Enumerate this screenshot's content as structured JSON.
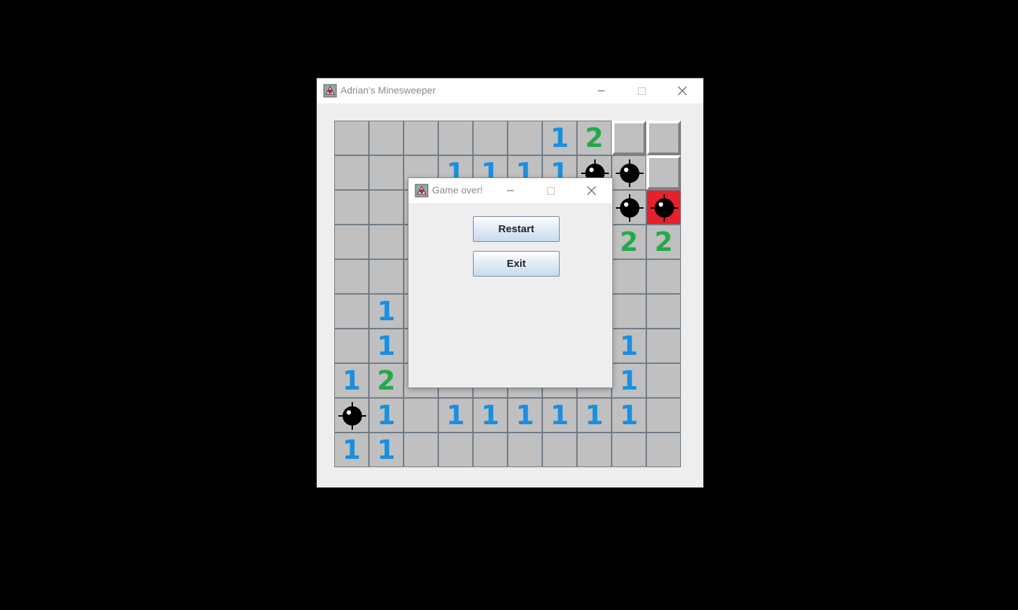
{
  "window": {
    "title": "Adrian's Minesweeper"
  },
  "dialog": {
    "title": "Game over!",
    "restart_label": "Restart",
    "exit_label": "Exit"
  },
  "colors": {
    "one": "#1a8fe0",
    "two": "#23a94a",
    "mine": "#000000",
    "exploded": "#e8202a"
  },
  "board": {
    "rows": 10,
    "cols": 10,
    "cells": [
      [
        "",
        "",
        "",
        "",
        "",
        "",
        "1",
        "2",
        "#",
        "#"
      ],
      [
        "",
        "",
        "",
        "1",
        "1",
        "1",
        "1",
        "*",
        "*",
        "#"
      ],
      [
        "",
        "",
        "",
        "",
        "",
        "",
        "",
        "",
        "*",
        "X"
      ],
      [
        "",
        "",
        "",
        "",
        "",
        "",
        "",
        "",
        "2",
        "2"
      ],
      [
        "",
        "",
        "",
        "",
        "",
        "",
        "",
        "",
        "",
        ""
      ],
      [
        "",
        "1",
        "",
        "",
        "",
        "",
        "",
        "",
        "",
        ""
      ],
      [
        "",
        "1",
        "",
        "",
        "",
        "",
        "",
        "",
        "1",
        ""
      ],
      [
        "1",
        "2",
        "",
        "",
        "",
        "",
        "",
        "",
        "1",
        ""
      ],
      [
        "*",
        "1",
        "",
        "1",
        "1",
        "1",
        "1",
        "1",
        "1",
        ""
      ],
      [
        "1",
        "1",
        "",
        "",
        "",
        "",
        "",
        "",
        "",
        ""
      ]
    ]
  }
}
